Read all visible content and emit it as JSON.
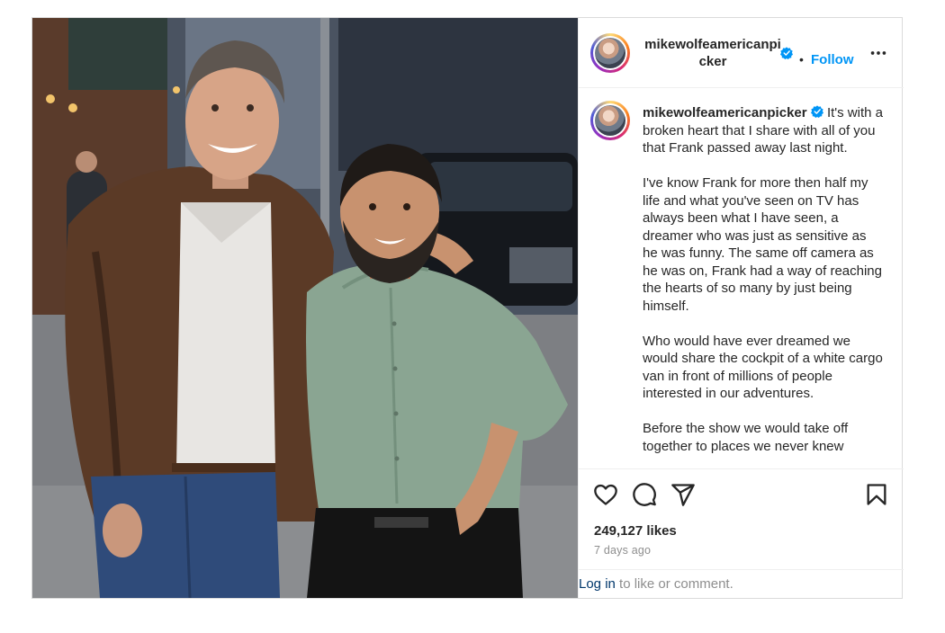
{
  "header": {
    "username": "mikewolfeamericanpicker",
    "follow_separator": "•",
    "follow_label": "Follow"
  },
  "caption": {
    "username": "mikewolfeamericanpicker",
    "paragraphs": [
      "It's with a broken heart that I share with all of you that Frank passed away last night.",
      "I've know Frank for more then half my life and what you've seen on TV has always been what I have seen, a dreamer who was just as sensitive as he was funny. The same off camera as he was on, Frank had a way of reaching the hearts of so many by just being himself.",
      "Who would have ever dreamed we would share the cockpit of a white cargo van in front of millions of people interested in our adventures.",
      "Before the show we would take off together to places we never knew"
    ]
  },
  "stats": {
    "likes": "249,127 likes",
    "time_ago": "7 days ago"
  },
  "login": {
    "link_label": "Log in",
    "suffix": " to like or comment."
  },
  "icons": {
    "like": "heart-icon",
    "comment": "comment-icon",
    "share": "share-icon",
    "save": "bookmark-icon",
    "more": "more-options-icon",
    "verified": "verified-badge-icon"
  },
  "colors": {
    "follow": "#0095f6",
    "verified": "#0095f6",
    "link": "#00376b",
    "muted": "#8e8e8e"
  }
}
